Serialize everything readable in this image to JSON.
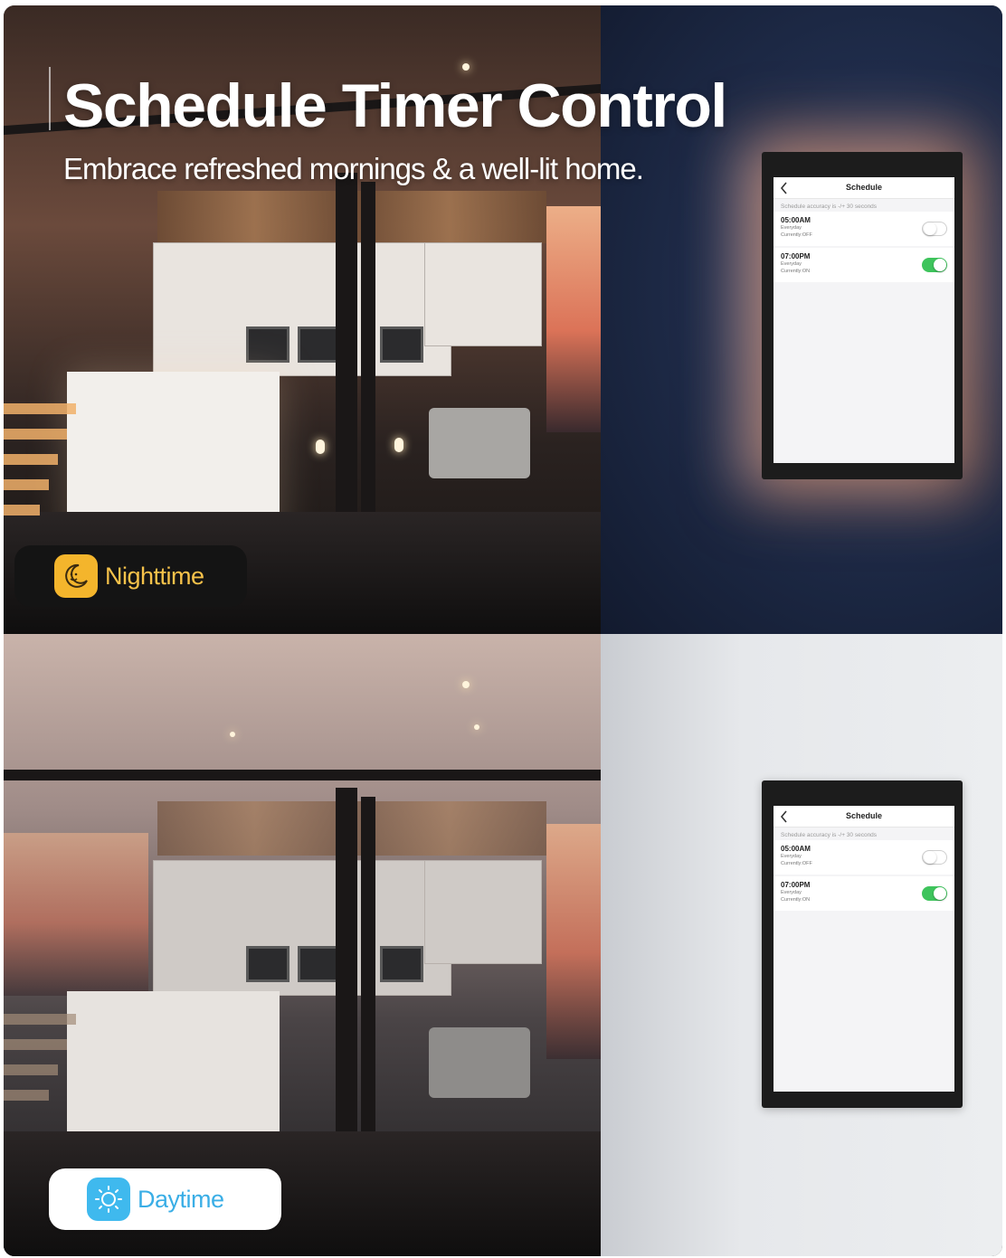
{
  "headline": "Schedule Timer Control",
  "subheadline": "Embrace refreshed mornings & a well-lit home.",
  "panels": {
    "night": {
      "badge_label": "Nighttime",
      "badge_icon": "moon-icon",
      "badge_color": "#f4b52c"
    },
    "day": {
      "badge_label": "Daytime",
      "badge_icon": "sun-icon",
      "badge_color": "#3fb9ee"
    }
  },
  "app": {
    "title": "Schedule",
    "accuracy_note": "Schedule accuracy is -/+ 30 seconds",
    "schedules": [
      {
        "time": "05:00AM",
        "repeat": "Everyday",
        "status": "Currently:OFF",
        "enabled": false
      },
      {
        "time": "07:00PM",
        "repeat": "Everyday",
        "status": "Currently:ON",
        "enabled": true
      }
    ],
    "toggle_on_color": "#3ec45c"
  }
}
